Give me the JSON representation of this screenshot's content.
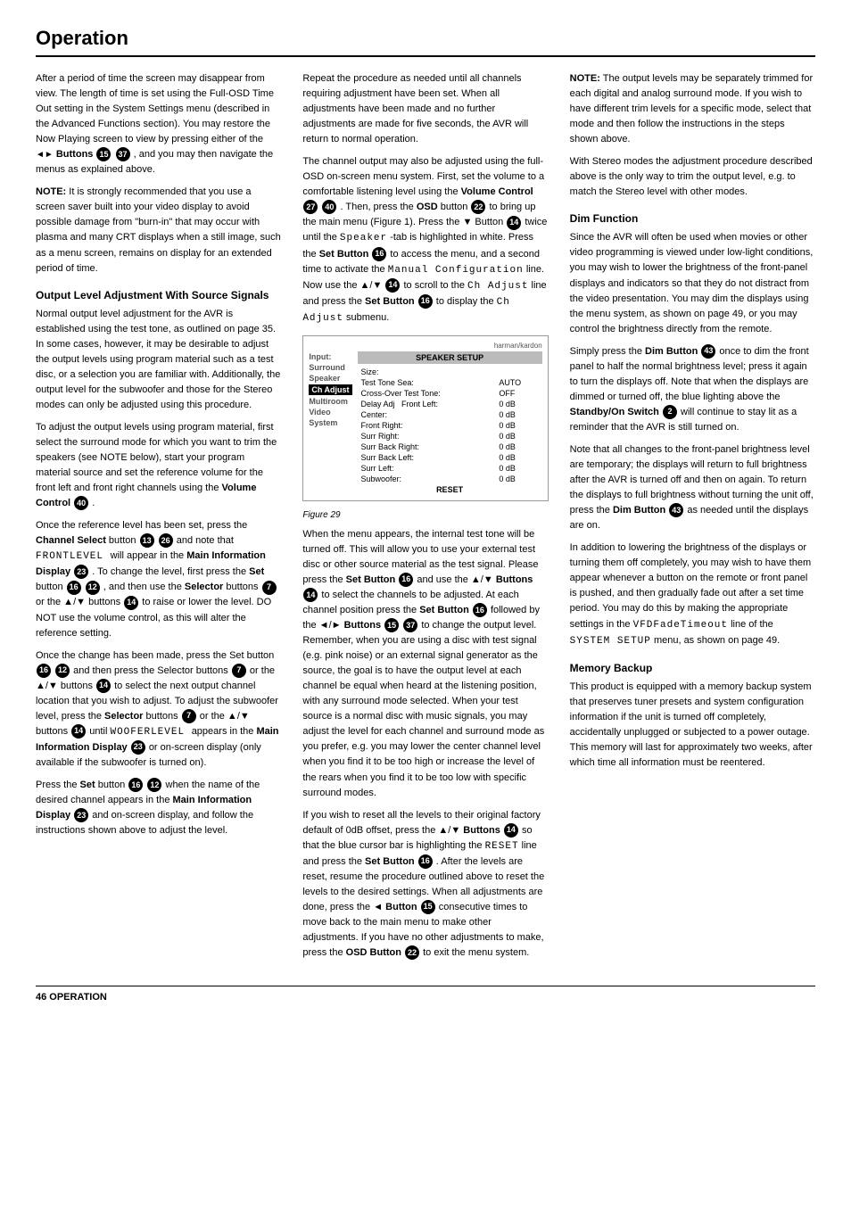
{
  "page": {
    "title": "Operation",
    "footer_page": "46  OPERATION"
  },
  "col1": {
    "intro": "After a period of time the screen may disappear from view. The length of time is set using the Full-OSD Time Out setting in the System Settings menu (described in the Advanced Functions section). You may restore the Now Playing screen to view by pressing either of the",
    "intro2": "Buttons",
    "badge_15": "15",
    "badge_37": "37",
    "intro3": ", and you may then navigate the menus as explained above.",
    "note1_label": "NOTE:",
    "note1": "It is strongly recommended that you use a screen saver built into your video display to avoid possible damage from \"burn-in\" that may occur with plasma and many CRT displays when a still image, such as a menu screen, remains on display for an extended period of time.",
    "section1_title": "Output Level Adjustment With Source Signals",
    "s1p1": "Normal output level adjustment for the AVR is established using the test tone, as outlined on page 35. In some cases, however, it may be desirable to adjust the output levels using program material such as a test disc, or a selection you are familiar with. Additionally, the output level for the subwoofer and those for the Stereo modes can only be adjusted using this procedure.",
    "s1p2": "To adjust the output levels using program material, first select the surround mode for which you want to trim the speakers (see NOTE below), start your program material source and set the reference volume for the front left and front right channels using the",
    "s1p2b": "Volume Control",
    "badge_40": "40",
    "s1p3_prefix": "Once the reference level has been set, press the",
    "s1p3_b1": "Channel Select",
    "s1p3_mid": "button",
    "badge_13": "13",
    "badge_26": "26",
    "s1p3_mid2": "and note that",
    "s1p3_mono": "FRONTLEVEL",
    "s1p3_mid3": "will appear in the",
    "s1p3_b2": "Main Information Display",
    "badge_23": "23",
    "s1p3_end": ". To change the level, first press the",
    "s1p3_b3": "Set",
    "s1p3_mid4": "button",
    "badge_16": "16",
    "badge_12": "12",
    "s1p3_mid5": ", and then use the",
    "s1p3_b4": "Selector",
    "s1p3_mid6": "buttons",
    "badge_7": "7",
    "s1p3_mid7": "or the ▲/▼ buttons",
    "badge_14": "14",
    "s1p3_end2": "to raise or lower the level. DO NOT use the volume control, as this will alter the reference setting.",
    "s1p4": "Once the change has been made, press the Set button",
    "s1p4_badges": [
      "16",
      "12"
    ],
    "s1p4_mid": "and then press the Selector buttons",
    "badge_7b": "7",
    "s1p4_mid2": "or the ▲/▼ buttons",
    "badge_14b": "14",
    "s1p4_end": "to select the next output channel location that you wish to adjust. To adjust the subwoofer level, press the",
    "s1p4_b": "Selector",
    "s1p4_mid3": "buttons",
    "badge_7c": "7",
    "s1p4_mid4": "or the ▲/▼ buttons",
    "badge_14c": "14",
    "s1p4_end2": "until",
    "s1p4_mono": "WOOFERLEVEL",
    "s1p4_end3": "appears in the",
    "s1p4_b2": "Main Information Display",
    "badge_23b": "23",
    "s1p4_end4": "or on-screen display (only available if the subwoofer is turned on).",
    "s1p5_prefix": "Press the",
    "s1p5_b1": "Set",
    "s1p5_mid": "button",
    "badge_16b": "16",
    "badge_12b": "12",
    "s1p5_mid2": "when the name of the desired channel appears in the",
    "s1p5_b2": "Main Information Display",
    "badge_23c": "23",
    "s1p5_end": "and on-screen display, and follow the instructions shown above to adjust the level."
  },
  "col2": {
    "p1": "Repeat the procedure as needed until all channels requiring adjustment have been set. When all adjustments have been made and no further adjustments are made for five seconds, the AVR will return to normal operation.",
    "p2_prefix": "The channel output may also be adjusted using the full-OSD on-screen menu system. First, set the volume to a comfortable listening level using the",
    "p2_b1": "Volume Control",
    "badge_27": "27",
    "badge_40b": "40",
    "p2_mid": ". Then, press the",
    "p2_b2": "OSD",
    "badge_22": "22",
    "p2_end": "button",
    "p2_end2": "to bring up the main menu (Figure 1). Press the ▼ Button",
    "badge_14d": "14",
    "p2_end3": "twice until the",
    "p2_mono": "Speaker",
    "p2_end4": "-tab is highlighted in white. Press the",
    "p2_b3": "Set Button",
    "badge_16c": "16",
    "p2_end5": "to access the menu, and a second time to activate the",
    "p2_mono2": "Manual Configuration",
    "p2_end6": "line. Now use the ▲/▼",
    "badge_14e": "14",
    "p2_end7": "to scroll to the",
    "p2_mono3": "Ch Adjust",
    "p2_end8": "line and press the",
    "p2_b4": "Set Button",
    "badge_16d": "16",
    "p2_end9": "to display the",
    "p2_mono4": "Ch Adjust",
    "p2_end10": "submenu.",
    "figure_title": "harman/kardon",
    "figure_label": "Figure 29",
    "figure_setup_header": "SPEAKER SETUP",
    "figure_nav": [
      "Input:",
      "Surround",
      "Speaker",
      "Multiroom",
      "Video",
      "System"
    ],
    "figure_highlight": "Ch Adjust",
    "figure_data": [
      {
        "label": "Size:",
        "value": ""
      },
      {
        "label": "Test Tone Sea:",
        "value": "AUTO"
      },
      {
        "label": "Cross-Over Test Tone:",
        "value": "OFF"
      },
      {
        "label": "Delay Adj  Front Left:",
        "value": "0 dB"
      },
      {
        "label": "Center:",
        "value": "0 dB"
      },
      {
        "label": "Front Right:",
        "value": "0 dB"
      },
      {
        "label": "Surr Right:",
        "value": "0 dB"
      },
      {
        "label": "Surr Back Right:",
        "value": "0 dB"
      },
      {
        "label": "Surr Back Left:",
        "value": "0 dB"
      },
      {
        "label": "Surr Left:",
        "value": "0 dB"
      },
      {
        "label": "Subwoofer:",
        "value": "0 dB"
      },
      {
        "label": "RESET",
        "value": ""
      }
    ],
    "p3": "When the menu appears, the internal test tone will be turned off. This will allow you to use your external test disc or other source material as the test signal. Please press the",
    "p3_b1": "Set Button",
    "badge_16e": "16",
    "p3_mid": "and use the ▲/▼",
    "p3_b2": "Buttons",
    "badge_14f": "14",
    "p3_end": "to select the channels to be adjusted. At each channel position press the",
    "p3_b3": "Set Button",
    "badge_16f": "16",
    "p3_mid2": "followed by the ◄/►",
    "p3_b4": "Buttons",
    "badge_15b": "15",
    "badge_37b": "37",
    "p3_end2": "to change the output level. Remember, when you are using a disc with test signal (e.g. pink noise) or an external signal generator as the source, the goal is to have the output level at each channel be equal when heard at the listening position, with any surround mode selected. When your test source is a normal disc with music signals, you may adjust the level for each channel and surround mode as you prefer, e.g. you may lower the center channel level when you find it to be too high or increase the level of the rears when you find it to be too low with specific surround modes.",
    "p4": "If you wish to reset all the levels to their original factory default of 0dB offset, press the ▲/▼",
    "p4_b1": "Buttons",
    "badge_14g": "14",
    "p4_mid": "so that the blue cursor bar is highlighting the",
    "p4_mono": "RESET",
    "p4_mid2": "line and press the",
    "p4_b2": "Set Button",
    "badge_16g": "16",
    "p4_end": ". After the levels are reset, resume the procedure outlined above to reset the levels to the desired settings. When all adjustments are done, press the ◄",
    "p4_b3": "Button",
    "badge_15c": "15",
    "p4_end2": "consecutive times to move back to the main menu to make other adjustments. If you have no other adjustments to make, press the",
    "p4_b4": "OSD Button",
    "badge_22b": "22",
    "p4_end3": "to exit the menu system."
  },
  "col3": {
    "note1_label": "NOTE:",
    "note1": "The output levels may be separately trimmed for each digital and analog surround mode. If you wish to have different trim levels for a specific mode, select that mode and then follow the instructions in the steps shown above.",
    "p1": "With Stereo modes the adjustment procedure described above is the only way to trim the output level, e.g. to match the Stereo level with other modes.",
    "section2_title": "Dim Function",
    "s2p1": "Since the AVR will often be used when movies or other video programming is viewed under low-light conditions, you may wish to lower the brightness of the front-panel displays and indicators so that they do not distract from the video presentation. You may dim the displays using the menu system, as shown on page 49, or you may control the brightness directly from the remote.",
    "s2p2_prefix": "Simply press the",
    "s2p2_b1": "Dim Button",
    "badge_43": "43",
    "s2p2_end": "once to dim the front panel to half the normal brightness level; press it again to turn the displays off. Note that when the displays are dimmed or turned off, the blue lighting above the",
    "s2p2_b2": "Standby/On Switch",
    "badge_2": "2",
    "s2p2_end2": "will continue to stay lit as a reminder that the AVR is still turned on.",
    "s2p3": "Note that all changes to the front-panel brightness level are temporary; the displays will return to full brightness after the AVR is turned off and then on again. To return the displays to full brightness without turning the unit off, press the",
    "s2p3_b1": "Dim Button",
    "badge_43b": "43",
    "s2p3_end": "as needed until the displays are on.",
    "s2p4": "In addition to lowering the brightness of the displays or turning them off completely, you may wish to have them appear whenever a button on the remote or front panel is pushed, and then gradually fade out after a set time period. You may do this by making the appropriate settings in the",
    "s2p4_mono": "VFDFadeTimeout",
    "s2p4_mid": "line of the",
    "s2p4_mono2": "SYSTEM SETUP",
    "s2p4_end": "menu, as shown on page 49.",
    "section3_title": "Memory Backup",
    "s3p1": "This product is equipped with a memory backup system that preserves tuner presets and system configuration information if the unit is turned off completely, accidentally unplugged or subjected to a power outage. This memory will last for approximately two weeks, after which time all information must be reentered."
  }
}
